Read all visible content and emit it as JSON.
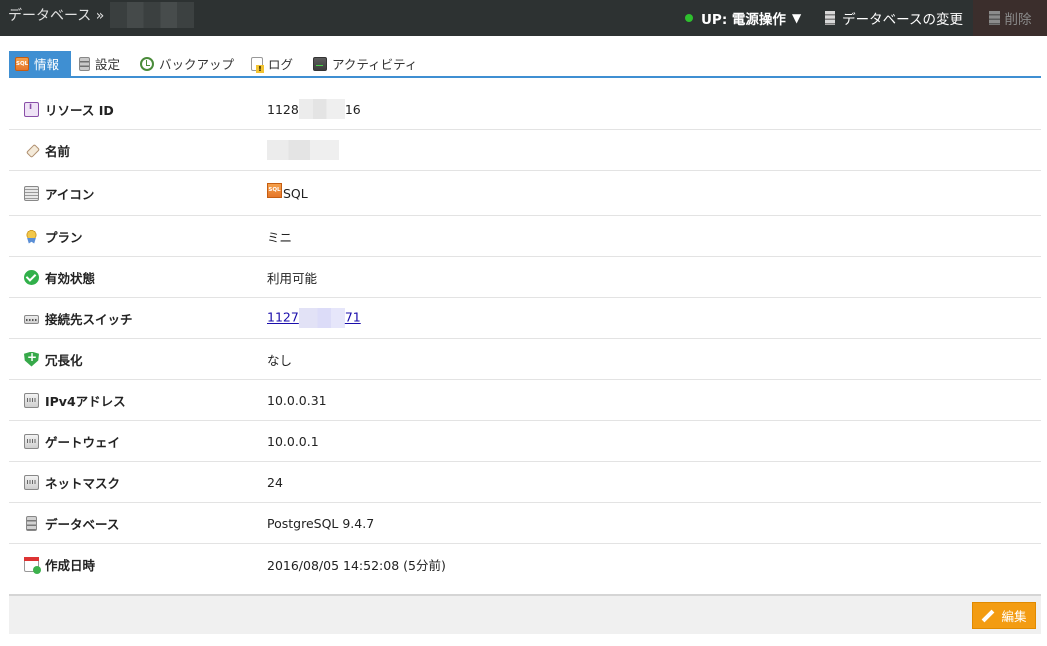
{
  "header": {
    "breadcrumb": "データベース »",
    "power_label": "UP: 電源操作",
    "power_caret": "▼",
    "change_db_label": "データベースの変更",
    "delete_label": "削除"
  },
  "tabs": [
    {
      "label": "情報",
      "icon": "sql-icon",
      "active": true
    },
    {
      "label": "設定",
      "icon": "settings-icon"
    },
    {
      "label": "バックアップ",
      "icon": "backup-icon"
    },
    {
      "label": "ログ",
      "icon": "log-icon"
    },
    {
      "label": "アクティビティ",
      "icon": "activity-icon"
    }
  ],
  "details": {
    "resource_id": {
      "label": "リソース ID",
      "value_prefix": "1128",
      "value_suffix": "16"
    },
    "name": {
      "label": "名前"
    },
    "icon": {
      "label": "アイコン",
      "value": "SQL"
    },
    "plan": {
      "label": "プラン",
      "value": "ミニ"
    },
    "availability": {
      "label": "有効状態",
      "value": "利用可能"
    },
    "switch": {
      "label": "接続先スイッチ",
      "value_prefix": "1127",
      "value_suffix": "71"
    },
    "redundancy": {
      "label": "冗長化",
      "value": "なし"
    },
    "ipv4": {
      "label": "IPv4アドレス",
      "value": "10.0.0.31"
    },
    "gateway": {
      "label": "ゲートウェイ",
      "value": "10.0.0.1"
    },
    "netmask": {
      "label": "ネットマスク",
      "value": "24"
    },
    "database": {
      "label": "データベース",
      "value": "PostgreSQL 9.4.7"
    },
    "created": {
      "label": "作成日時",
      "value": "2016/08/05 14:52:08 (5分前)"
    }
  },
  "footer": {
    "edit_label": "編集"
  }
}
